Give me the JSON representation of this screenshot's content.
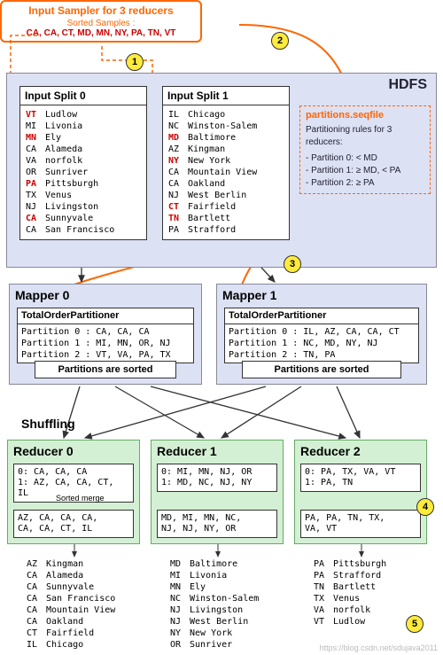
{
  "sampler": {
    "title": "Input Sampler for 3 reducers",
    "sub": "Sorted Samples :",
    "vals": "CA, CA, CT, MD, MN, NY, PA, TN, VT"
  },
  "hdfs": {
    "label": "HDFS"
  },
  "split0": {
    "title": "Input Split 0",
    "rows": [
      [
        "VT",
        "Ludlow",
        1
      ],
      [
        "MI",
        "Livonia",
        0
      ],
      [
        "MN",
        "Ely",
        1
      ],
      [
        "CA",
        "Alameda",
        0
      ],
      [
        "VA",
        "norfolk",
        0
      ],
      [
        "OR",
        "Sunriver",
        0
      ],
      [
        "PA",
        "Pittsburgh",
        1
      ],
      [
        "TX",
        "Venus",
        0
      ],
      [
        "NJ",
        "Livingston",
        0
      ],
      [
        "CA",
        "Sunnyvale",
        1
      ],
      [
        "CA",
        "San Francisco",
        0
      ]
    ]
  },
  "split1": {
    "title": "Input Split 1",
    "rows": [
      [
        "IL",
        "Chicago",
        0
      ],
      [
        "NC",
        "Winston-Salem",
        0
      ],
      [
        "MD",
        "Baltimore",
        1
      ],
      [
        "AZ",
        "Kingman",
        0
      ],
      [
        "NY",
        "New York",
        1
      ],
      [
        "CA",
        "Mountain View",
        0
      ],
      [
        "CA",
        "Oakland",
        0
      ],
      [
        "NJ",
        "West Berlin",
        0
      ],
      [
        "CT",
        "Fairfield",
        1
      ],
      [
        "TN",
        "Bartlett",
        1
      ],
      [
        "PA",
        "Strafford",
        0
      ]
    ]
  },
  "seq": {
    "title": "partitions.seqfile",
    "desc": "Partitioning rules for 3 reducers:",
    "r0": "- Partition 0: < MD",
    "r1": "- Partition 1: ≥ MD, < PA",
    "r2": "- Partition 2: ≥ PA"
  },
  "mapper0": {
    "title": "Mapper 0",
    "top": "TotalOrderPartitioner",
    "p0": "Partition 0 : CA, CA, CA",
    "p1": "Partition 1 : MI, MN, OR, NJ",
    "p2": "Partition 2 : VT, VA, PA, TX",
    "sorted": "Partitions are sorted"
  },
  "mapper1": {
    "title": "Mapper 1",
    "top": "TotalOrderPartitioner",
    "p0": "Partition 0 : IL, AZ, CA, CA, CT",
    "p1": "Partition 1 : NC, MD, NY, NJ",
    "p2": "Partition 2 : TN, PA",
    "sorted": "Partitions are sorted"
  },
  "shuffle": "Shuffling",
  "reducer0": {
    "title": "Reducer 0",
    "l0": "0: CA, CA, CA",
    "l1": "1: AZ, CA, CA, CT, IL",
    "merge": "Sorted merge",
    "out": "AZ, CA, CA, CA,\nCA, CA, CT, IL"
  },
  "reducer1": {
    "title": "Reducer 1",
    "l0": "0: MI, MN, NJ, OR",
    "l1": "1: MD, NC, NJ, NY",
    "out": "MD, MI, MN, NC,\nNJ, NJ, NY, OR"
  },
  "reducer2": {
    "title": "Reducer 2",
    "l0": "0: PA, TX, VA, VT",
    "l1": "1: PA, TN",
    "out": "PA, PA, TN, TX,\nVA, VT"
  },
  "out0": [
    [
      "AZ",
      "Kingman"
    ],
    [
      "CA",
      "Alameda"
    ],
    [
      "CA",
      "Sunnyvale"
    ],
    [
      "CA",
      "San Francisco"
    ],
    [
      "CA",
      "Mountain View"
    ],
    [
      "CA",
      "Oakland"
    ],
    [
      "CT",
      "Fairfield"
    ],
    [
      "IL",
      "Chicago"
    ]
  ],
  "out1": [
    [
      "MD",
      "Baltimore"
    ],
    [
      "MI",
      "Livonia"
    ],
    [
      "MN",
      "Ely"
    ],
    [
      "NC",
      "Winston-Salem"
    ],
    [
      "NJ",
      "Livingston"
    ],
    [
      "NJ",
      "West Berlin"
    ],
    [
      "NY",
      "New York"
    ],
    [
      "OR",
      "Sunriver"
    ]
  ],
  "out2": [
    [
      "PA",
      "Pittsburgh"
    ],
    [
      "PA",
      "Strafford"
    ],
    [
      "TN",
      "Bartlett"
    ],
    [
      "TX",
      "Venus"
    ],
    [
      "VA",
      "norfolk"
    ],
    [
      "VT",
      "Ludlow"
    ]
  ],
  "badges": {
    "b1": "1",
    "b2": "2",
    "b3": "3",
    "b4": "4",
    "b5": "5"
  },
  "watermark": "https://blog.csdn.net/sdujava2011"
}
